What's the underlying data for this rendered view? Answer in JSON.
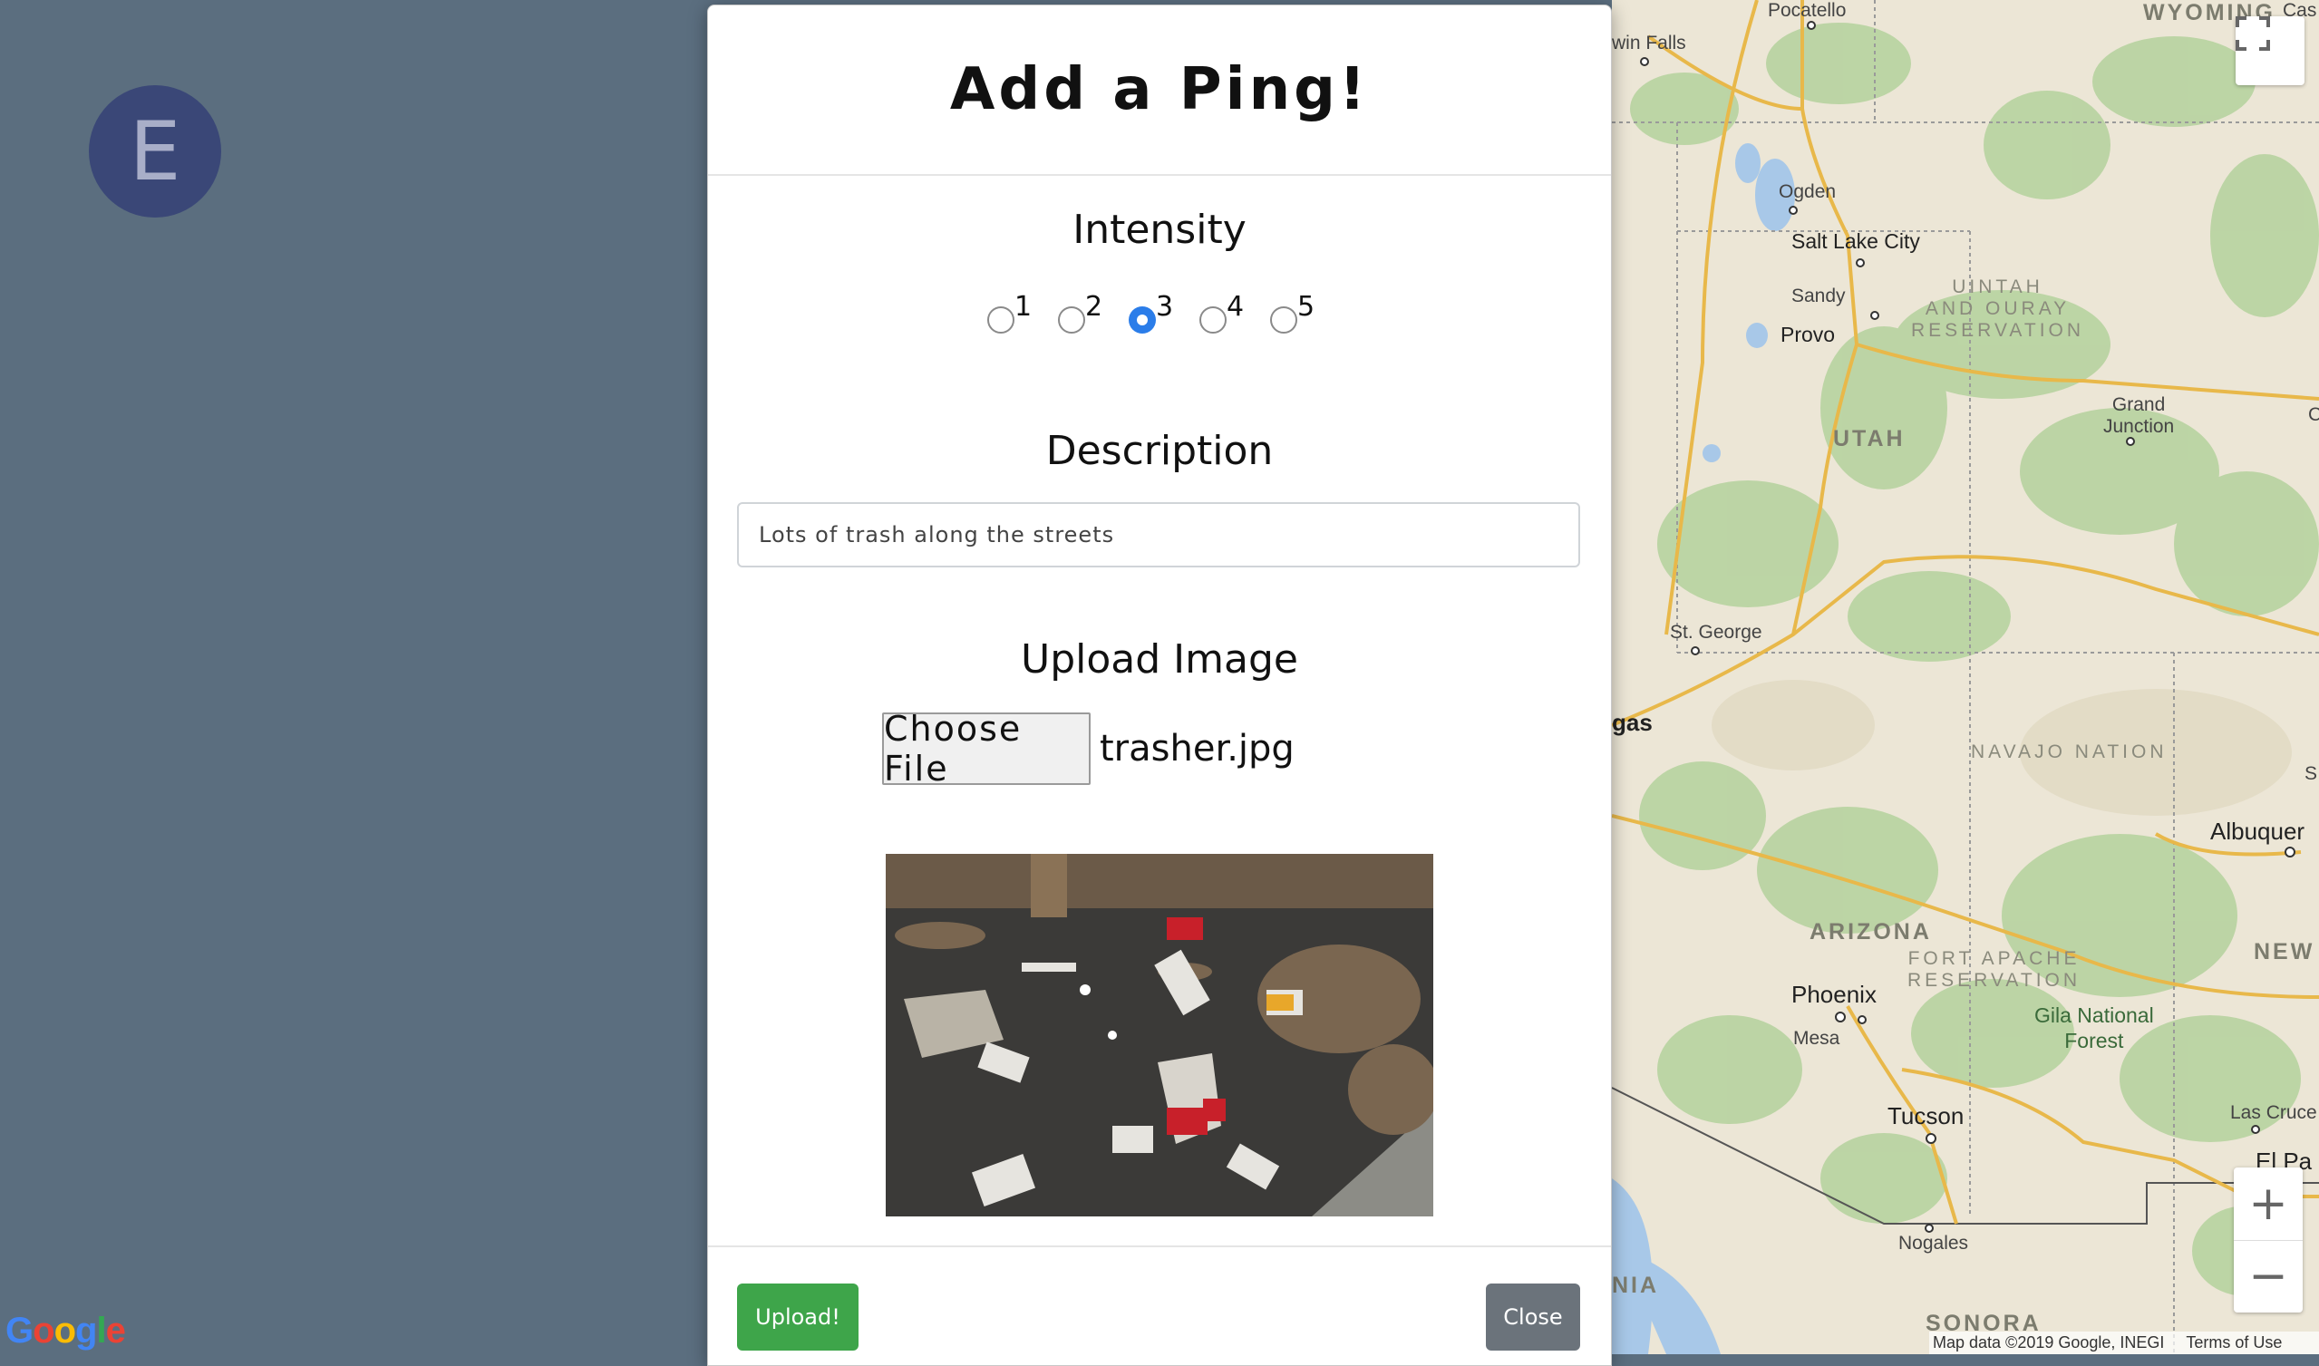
{
  "avatar": {
    "initial": "E"
  },
  "map": {
    "labels": {
      "pocatello": "Pocatello",
      "wyoming": "WYOMING",
      "cas": "Cas",
      "twin_falls": "win Falls",
      "ogden": "Ogden",
      "salt_lake_city": "Salt Lake City",
      "sandy": "Sandy",
      "provo": "Provo",
      "uintah": "UINTAH\nAND OURAY\nRESERVATION",
      "utah": "UTAH",
      "grand_junction": "Grand\nJunction",
      "st_george": "St. George",
      "gas": "gas",
      "navajo": "NAVAJO NATION",
      "albuquerque": "Albuquer",
      "arizona": "ARIZONA",
      "fort_apache": "FORT APACHE\nRESERVATION",
      "new": "NEW",
      "phoenix": "Phoenix",
      "mesa": "Mesa",
      "gila": "Gila National\nForest",
      "tucson": "Tucson",
      "las_cruces": "Las Cruce",
      "el_paso": "El Pa",
      "nogales": "Nogales",
      "nia": "NIA",
      "sonora": "SONORA",
      "s_edge": "S",
      "c_edge": "C"
    },
    "attribution": "Map data ©2019 Google, INEGI",
    "terms": "Terms of Use",
    "logo": "Google",
    "logo_colors": [
      "#4285F4",
      "#EA4335",
      "#FBBC05",
      "#4285F4",
      "#34A853",
      "#EA4335"
    ],
    "zoom_in": "+",
    "zoom_out": "−"
  },
  "modal": {
    "title": "Add a Ping!",
    "intensity_label": "Intensity",
    "intensity_options": [
      "1",
      "2",
      "3",
      "4",
      "5"
    ],
    "intensity_selected": "3",
    "description_label": "Description",
    "description_value": "Lots of trash along the streets",
    "upload_label": "Upload Image",
    "choose_file_label": "Choose File",
    "file_name": "trasher.jpg",
    "upload_button": "Upload!",
    "close_button": "Close",
    "accent_color": "#2b7de9",
    "upload_color": "#3ea54a",
    "close_color": "#6b737b"
  }
}
